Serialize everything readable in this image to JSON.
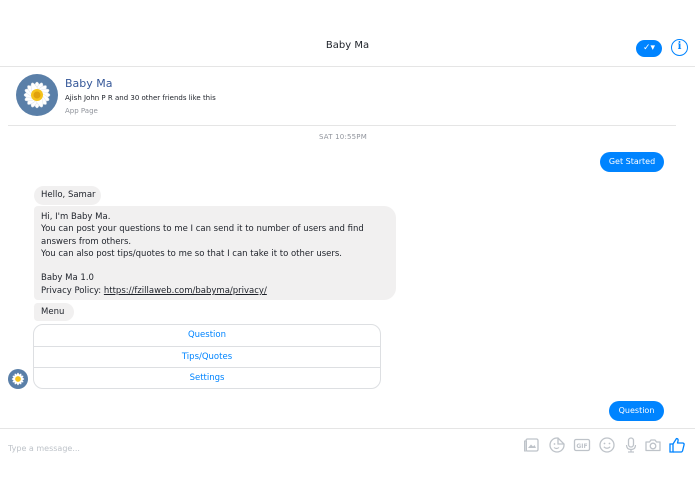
{
  "header": {
    "title": "Baby Ma"
  },
  "page_card": {
    "name": "Baby Ma",
    "likes_text": "Ajish John P R and 30 other friends like this",
    "type": "App Page"
  },
  "conversation": {
    "timestamp": "SAT 10:55PM",
    "get_started_label": "Get Started",
    "greeting": "Hello, Samar",
    "intro_lines": [
      "Hi, I'm Baby Ma.",
      "You can post your questions to me I can send it to number of users and find",
      "answers from others.",
      "You can also post tips/quotes to me so that I can take it to other users.",
      "Baby Ma 1.0"
    ],
    "privacy_prefix": "Privacy Policy: ",
    "privacy_link": "https://fzillaweb.com/babyma/privacy/",
    "menu_label": "Menu",
    "menu_buttons": [
      "Question",
      "Tips/Quotes",
      "Settings"
    ],
    "sent_reply": "Question"
  },
  "composer": {
    "placeholder": "Type a message...",
    "tools": [
      "image-icon",
      "sticker-icon",
      "gif-icon",
      "emoji-icon",
      "microphone-icon",
      "camera-icon",
      "thumbs-up-icon"
    ]
  },
  "colors": {
    "accent": "#0084ff",
    "incoming_bubble": "#f1f0f0",
    "page_name": "#365899",
    "muted": "#90949c",
    "icon_gray": "#bec3c9"
  }
}
